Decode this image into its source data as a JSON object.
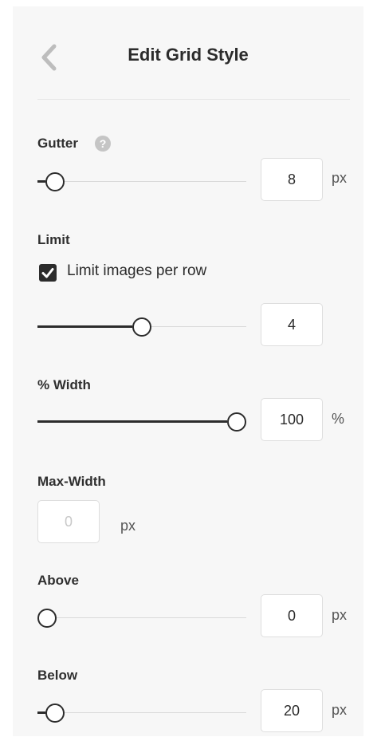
{
  "header": {
    "title": "Edit Grid Style",
    "back_icon": "chevron-left-icon"
  },
  "gutter": {
    "label": "Gutter",
    "help_icon": "question-icon",
    "help_glyph": "?",
    "value": "8",
    "unit": "px",
    "fraction": 0.04
  },
  "limit": {
    "label": "Limit",
    "checkbox_label": "Limit images per row",
    "checked": true,
    "value": "4",
    "fraction": 0.5
  },
  "width": {
    "label": "% Width",
    "value": "100",
    "unit": "%",
    "fraction": 1.0
  },
  "max_width": {
    "label": "Max-Width",
    "value": "0",
    "unit": "px"
  },
  "above": {
    "label": "Above",
    "value": "0",
    "unit": "px",
    "fraction": 0.0
  },
  "below": {
    "label": "Below",
    "value": "20",
    "unit": "px",
    "fraction": 0.04
  },
  "colors": {
    "panel": "#f7f7f7",
    "text": "#2c2c2c",
    "track": "#d9d9d9"
  }
}
